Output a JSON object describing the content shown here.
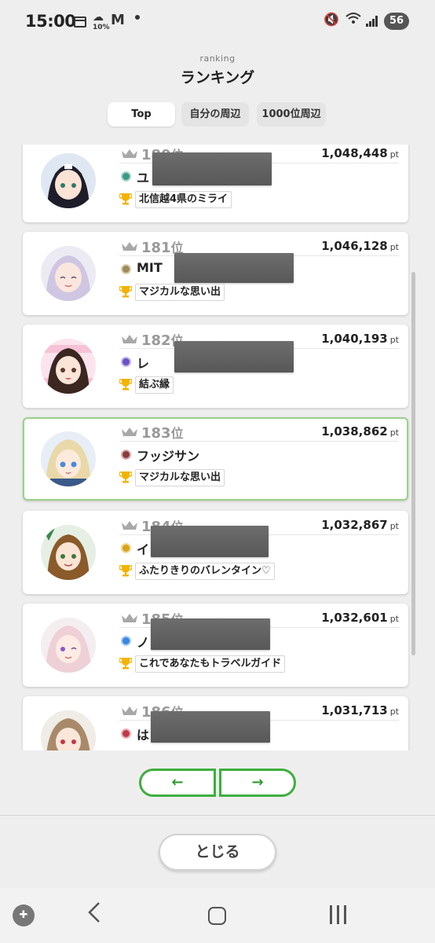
{
  "status_bar": {
    "time": "15:00",
    "weather_pct": "10%",
    "battery": "56"
  },
  "header": {
    "subtitle": "ranking",
    "title": "ランキング"
  },
  "tabs": [
    {
      "label": "Top",
      "active": true
    },
    {
      "label": "自分の周辺",
      "active": false
    },
    {
      "label": "1000位周辺",
      "active": false
    }
  ],
  "ranking": {
    "rank_suffix": "位",
    "score_unit": "pt",
    "entries": [
      {
        "rank": "180",
        "score": "1,048,448",
        "name": "ユ",
        "title": "北信越4県のミライ",
        "emblem_color": "#3d9a86",
        "highlight": false
      },
      {
        "rank": "181",
        "score": "1,046,128",
        "name": "MIT",
        "title": "マジカルな思い出",
        "emblem_color": "#9b8b5a",
        "highlight": false
      },
      {
        "rank": "182",
        "score": "1,040,193",
        "name": "レ",
        "title": "結ぶ縁",
        "emblem_color": "#6b4fc6",
        "highlight": false
      },
      {
        "rank": "183",
        "score": "1,038,862",
        "name": "フッジサン",
        "title": "マジカルな思い出",
        "emblem_color": "#8a3b3b",
        "highlight": true
      },
      {
        "rank": "184",
        "score": "1,032,867",
        "name": "イ",
        "title": "ふたりきりのバレンタイン♡",
        "emblem_color": "#d9a21a",
        "highlight": false
      },
      {
        "rank": "185",
        "score": "1,032,601",
        "name": "ノ",
        "title": "これであなたもトラベルガイド",
        "emblem_color": "#3a86e0",
        "highlight": false
      },
      {
        "rank": "186",
        "score": "1,031,713",
        "name": "は",
        "title": "",
        "emblem_color": "#c0394b",
        "highlight": false
      }
    ]
  },
  "pager": {
    "prev": "←",
    "next": "→"
  },
  "close_button": "とじる",
  "colors": {
    "accent_green": "#3eae3e",
    "highlight_border": "#9ad18b",
    "rank_gray": "#999999",
    "trophy_gold": "#f2b300"
  }
}
